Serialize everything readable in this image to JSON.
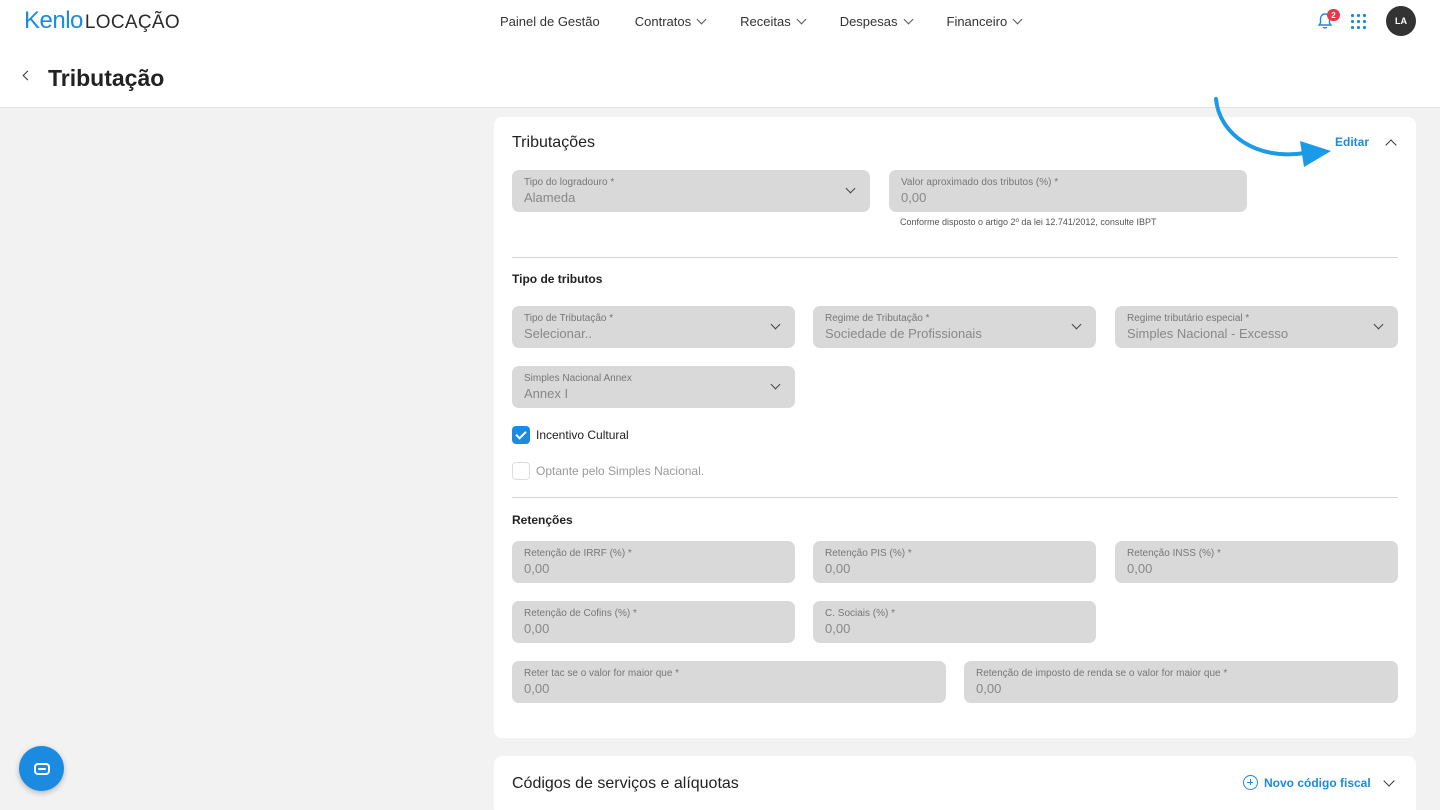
{
  "brand": {
    "name": "Kenlo",
    "product": "LOCAÇÃO",
    "color": "#1a8be0"
  },
  "nav": {
    "items": [
      {
        "label": "Painel de Gestão",
        "dropdown": false
      },
      {
        "label": "Contratos",
        "dropdown": true
      },
      {
        "label": "Receitas",
        "dropdown": true
      },
      {
        "label": "Despesas",
        "dropdown": true
      },
      {
        "label": "Financeiro",
        "dropdown": true
      }
    ],
    "notifications_count": "2",
    "avatar_initials": "LA"
  },
  "page": {
    "title": "Tributação"
  },
  "tributacoes": {
    "title": "Tributações",
    "edit_label": "Editar",
    "tipo_logradouro": {
      "label": "Tipo do logradouro *",
      "value": "Alameda"
    },
    "valor_aproximado": {
      "label": "Valor aproximado dos tributos (%) *",
      "value": "0,00"
    },
    "valor_hint": "Conforme disposto o artigo 2º da lei 12.741/2012, consulte IBPT",
    "tipo_tributos": {
      "title": "Tipo de tributos",
      "tipo_tributacao": {
        "label": "Tipo de Tributação *",
        "value": "Selecionar.."
      },
      "regime_tributacao": {
        "label": "Regime de Tributação *",
        "value": "Sociedade de Profissionais"
      },
      "regime_especial": {
        "label": "Regime tributário especial *",
        "value": "Simples Nacional - Excesso"
      },
      "simples_annex": {
        "label": "Simples Nacional Annex",
        "value": "Annex I"
      },
      "incentivo_cultural": {
        "label": "Incentivo Cultural",
        "checked": true
      },
      "optante_simples": {
        "label": "Optante pelo Simples Nacional.",
        "checked": false
      }
    },
    "retencoes": {
      "title": "Retenções",
      "irrf": {
        "label": "Retenção de IRRF (%) *",
        "value": "0,00"
      },
      "pis": {
        "label": "Retenção PIS (%) *",
        "value": "0,00"
      },
      "inss": {
        "label": "Retenção INSS (%) *",
        "value": "0,00"
      },
      "cofins": {
        "label": "Retenção de Cofins (%) *",
        "value": "0,00"
      },
      "c_sociais": {
        "label": "C. Sociais (%) *",
        "value": "0,00"
      },
      "reter_tac": {
        "label": "Reter tac se o valor for maior que *",
        "value": "0,00"
      },
      "retencao_ir": {
        "label": "Retenção de imposto de renda se o valor for maior que *",
        "value": "0,00"
      }
    }
  },
  "codigos": {
    "title": "Códigos de serviços e alíquotas",
    "add_label": "Novo código fiscal"
  }
}
